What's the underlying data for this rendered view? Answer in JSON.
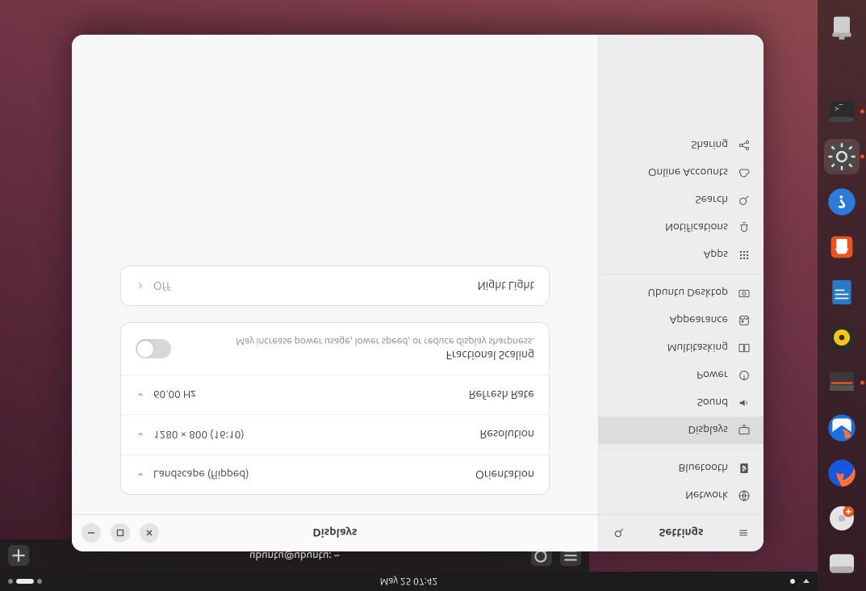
{
  "topbar": {
    "datetime": "May 25  07:42"
  },
  "dock": {
    "items": [
      {
        "name": "files-icon"
      },
      {
        "name": "disks-icon"
      },
      {
        "name": "firefox-icon"
      },
      {
        "name": "thunderbird-icon"
      },
      {
        "name": "nautilus-icon"
      },
      {
        "name": "rhythmbox-icon"
      },
      {
        "name": "libreoffice-writer-icon"
      },
      {
        "name": "software-store-icon"
      },
      {
        "name": "help-icon"
      },
      {
        "name": "settings-icon"
      },
      {
        "name": "terminal-icon"
      },
      {
        "name": "trash-icon"
      }
    ]
  },
  "terminal": {
    "title": "ubuntu@ubuntu: ~"
  },
  "settings": {
    "header": {
      "title": "Settings"
    },
    "content": {
      "title": "Displays",
      "rows": {
        "orientation": {
          "label": "Orientation",
          "value": "Landscape (flipped)"
        },
        "resolution": {
          "label": "Resolution",
          "value": "1280 × 800 (16∶10)"
        },
        "refresh": {
          "label": "Refresh Rate",
          "value": "60.00 Hz"
        },
        "fractional": {
          "label": "Fractional Scaling",
          "sub": "May increase power usage, lower speed, or reduce display sharpness.",
          "on": false
        },
        "nightlight": {
          "label": "Night Light",
          "value": "Off"
        }
      }
    },
    "sidebar": {
      "groups": [
        [
          {
            "label": "Network",
            "icon": "network"
          },
          {
            "label": "Bluetooth",
            "icon": "bluetooth"
          }
        ],
        [
          {
            "label": "Displays",
            "icon": "displays",
            "active": true
          },
          {
            "label": "Sound",
            "icon": "sound"
          },
          {
            "label": "Power",
            "icon": "power"
          },
          {
            "label": "Multitasking",
            "icon": "multitasking"
          },
          {
            "label": "Appearance",
            "icon": "appearance"
          },
          {
            "label": "Ubuntu Desktop",
            "icon": "ubuntu"
          }
        ],
        [
          {
            "label": "Apps",
            "icon": "apps"
          },
          {
            "label": "Notifications",
            "icon": "notifications"
          },
          {
            "label": "Search",
            "icon": "search"
          },
          {
            "label": "Online Accounts",
            "icon": "cloud"
          },
          {
            "label": "Sharing",
            "icon": "sharing"
          }
        ]
      ]
    }
  }
}
